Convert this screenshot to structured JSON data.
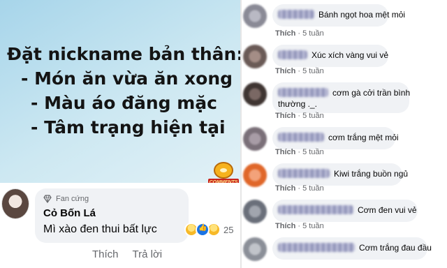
{
  "post": {
    "lines": [
      "Đặt nickname bản thân:",
      "- Món ăn vừa ăn xong",
      "- Màu áo đăng mặc",
      "- Tâm trạng hiện tại"
    ],
    "logo_text": "COMMENTS"
  },
  "featured_comment": {
    "badge": "Fan cứng",
    "name": "Cỏ Bốn Lá",
    "text": "Mì xào đen thui bất lực",
    "reaction_count": "25",
    "actions": [
      "Thích",
      "Trả lời"
    ]
  },
  "comments": [
    {
      "text": "Bánh ngọt hoa mệt mỏi",
      "like": "Thích",
      "time": "5 tuần",
      "avatar_color": "#8a8a96"
    },
    {
      "text": "Xúc xích vàng vui vẻ",
      "like": "Thích",
      "time": "5 tuần",
      "avatar_color": "#6a5a56"
    },
    {
      "text": "cơm gà cởi trần bình",
      "text2": "thường ._.",
      "like": "Thích",
      "time": "5 tuần",
      "avatar_color": "#3f3532"
    },
    {
      "text": "cơm trắng mệt mỏi",
      "like": "Thích",
      "time": "5 tuần",
      "avatar_color": "#7a6f78"
    },
    {
      "text": "Kiwi trắng buồn ngủ",
      "like": "Thích",
      "time": "5 tuần",
      "avatar_color": "#e0672a"
    },
    {
      "text": "Cơm đen vui vẻ",
      "like": "Thích",
      "time": "5 tuần",
      "avatar_color": "#6a6f7a"
    },
    {
      "text": "Cơm trắng đau đầu",
      "like": "",
      "time": "",
      "avatar_color": "#8b8f98"
    }
  ],
  "colors": {
    "bubble": "#f0f2f5",
    "meta_text": "#65676b",
    "name_blur": "#8c8fb5"
  }
}
